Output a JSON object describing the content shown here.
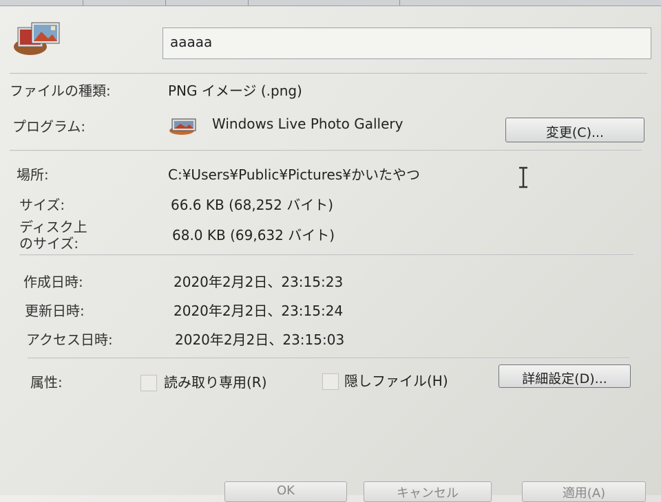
{
  "filename": "aaaaa",
  "type": {
    "label": "ファイルの種類:",
    "value": "PNG イメージ (.png)"
  },
  "program": {
    "label": "プログラム:",
    "value": "Windows Live Photo Gallery",
    "change_button": "変更(C)..."
  },
  "location": {
    "label": "場所:",
    "value": "C:¥Users¥Public¥Pictures¥かいたやつ"
  },
  "size": {
    "label": "サイズ:",
    "value": "66.6 KB (68,252 バイト)"
  },
  "size_on_disk": {
    "label_line1": "ディスク上",
    "label_line2": "のサイズ:",
    "value": "68.0 KB (69,632 バイト)"
  },
  "created": {
    "label": "作成日時:",
    "value": "2020年2月2日、23:15:23"
  },
  "modified": {
    "label": "更新日時:",
    "value": "2020年2月2日、23:15:24"
  },
  "accessed": {
    "label": "アクセス日時:",
    "value": "2020年2月2日、23:15:03"
  },
  "attributes": {
    "label": "属性:",
    "readonly_label": "読み取り専用(R)",
    "readonly_checked": false,
    "hidden_label": "隠しファイル(H)",
    "hidden_checked": false,
    "advanced_button": "詳細設定(D)..."
  },
  "footer": {
    "ok": "OK",
    "cancel": "キャンセル",
    "apply": "適用(A)"
  },
  "icons": {
    "file": "photo-file-icon",
    "program": "photo-gallery-icon",
    "cursor": "text-cursor-icon"
  }
}
